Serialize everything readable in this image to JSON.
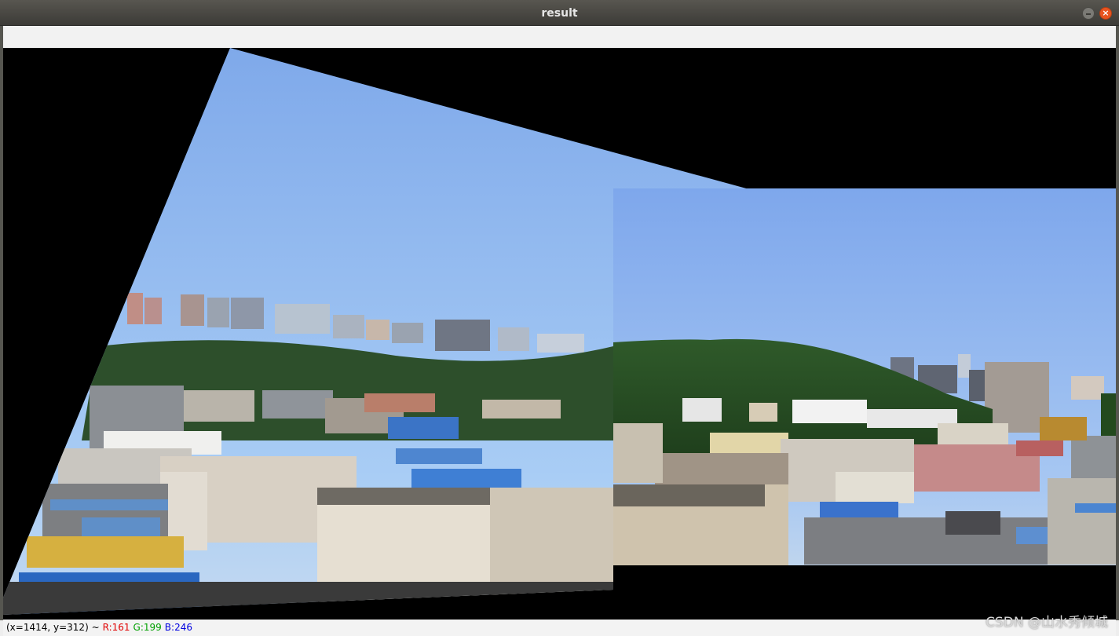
{
  "window": {
    "title": "result",
    "buttons": {
      "minimize_icon": "minimize-icon",
      "close_icon": "close-icon",
      "close_glyph": "×"
    }
  },
  "image": {
    "description_icon": "stitched-panorama-image",
    "background_color": "#000000"
  },
  "status": {
    "coords": "(x=1414, y=312) ~",
    "r": "R:161",
    "g": "G:199",
    "b": "B:246"
  },
  "watermark": "CSDN @山水秀倾城",
  "colors": {
    "titlebar": "#3c3b37",
    "close_button": "#e95420",
    "r_text": "#e00000",
    "g_text": "#00a000",
    "b_text": "#0000e0"
  }
}
